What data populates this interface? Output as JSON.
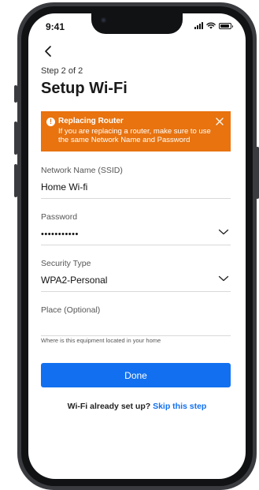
{
  "status_bar": {
    "time": "9:41"
  },
  "header": {
    "step": "Step 2 of 2",
    "title": "Setup Wi-Fi"
  },
  "alert": {
    "title": "Replacing Router",
    "body": "If you are replacing a router, make sure to use the same Network Name and Password",
    "color": "#e8730f"
  },
  "form": {
    "ssid": {
      "label": "Network Name (SSID)",
      "value": "Home Wi-fi"
    },
    "password": {
      "label": "Password",
      "value": "•••••••••••"
    },
    "security": {
      "label": "Security Type",
      "value": "WPA2-Personal"
    },
    "place": {
      "label": "Place (Optional)",
      "value": "",
      "helper": "Where is this equipment located in your home"
    }
  },
  "actions": {
    "done_label": "Done",
    "accent": "#1270f0"
  },
  "footer": {
    "prompt": "Wi-Fi already set up?",
    "skip_label": "Skip this step"
  },
  "icons": [
    "back-chevron-icon",
    "info-icon",
    "close-icon",
    "chevron-down-icon",
    "signal-icon",
    "wifi-icon",
    "battery-icon",
    "camera-icon"
  ]
}
